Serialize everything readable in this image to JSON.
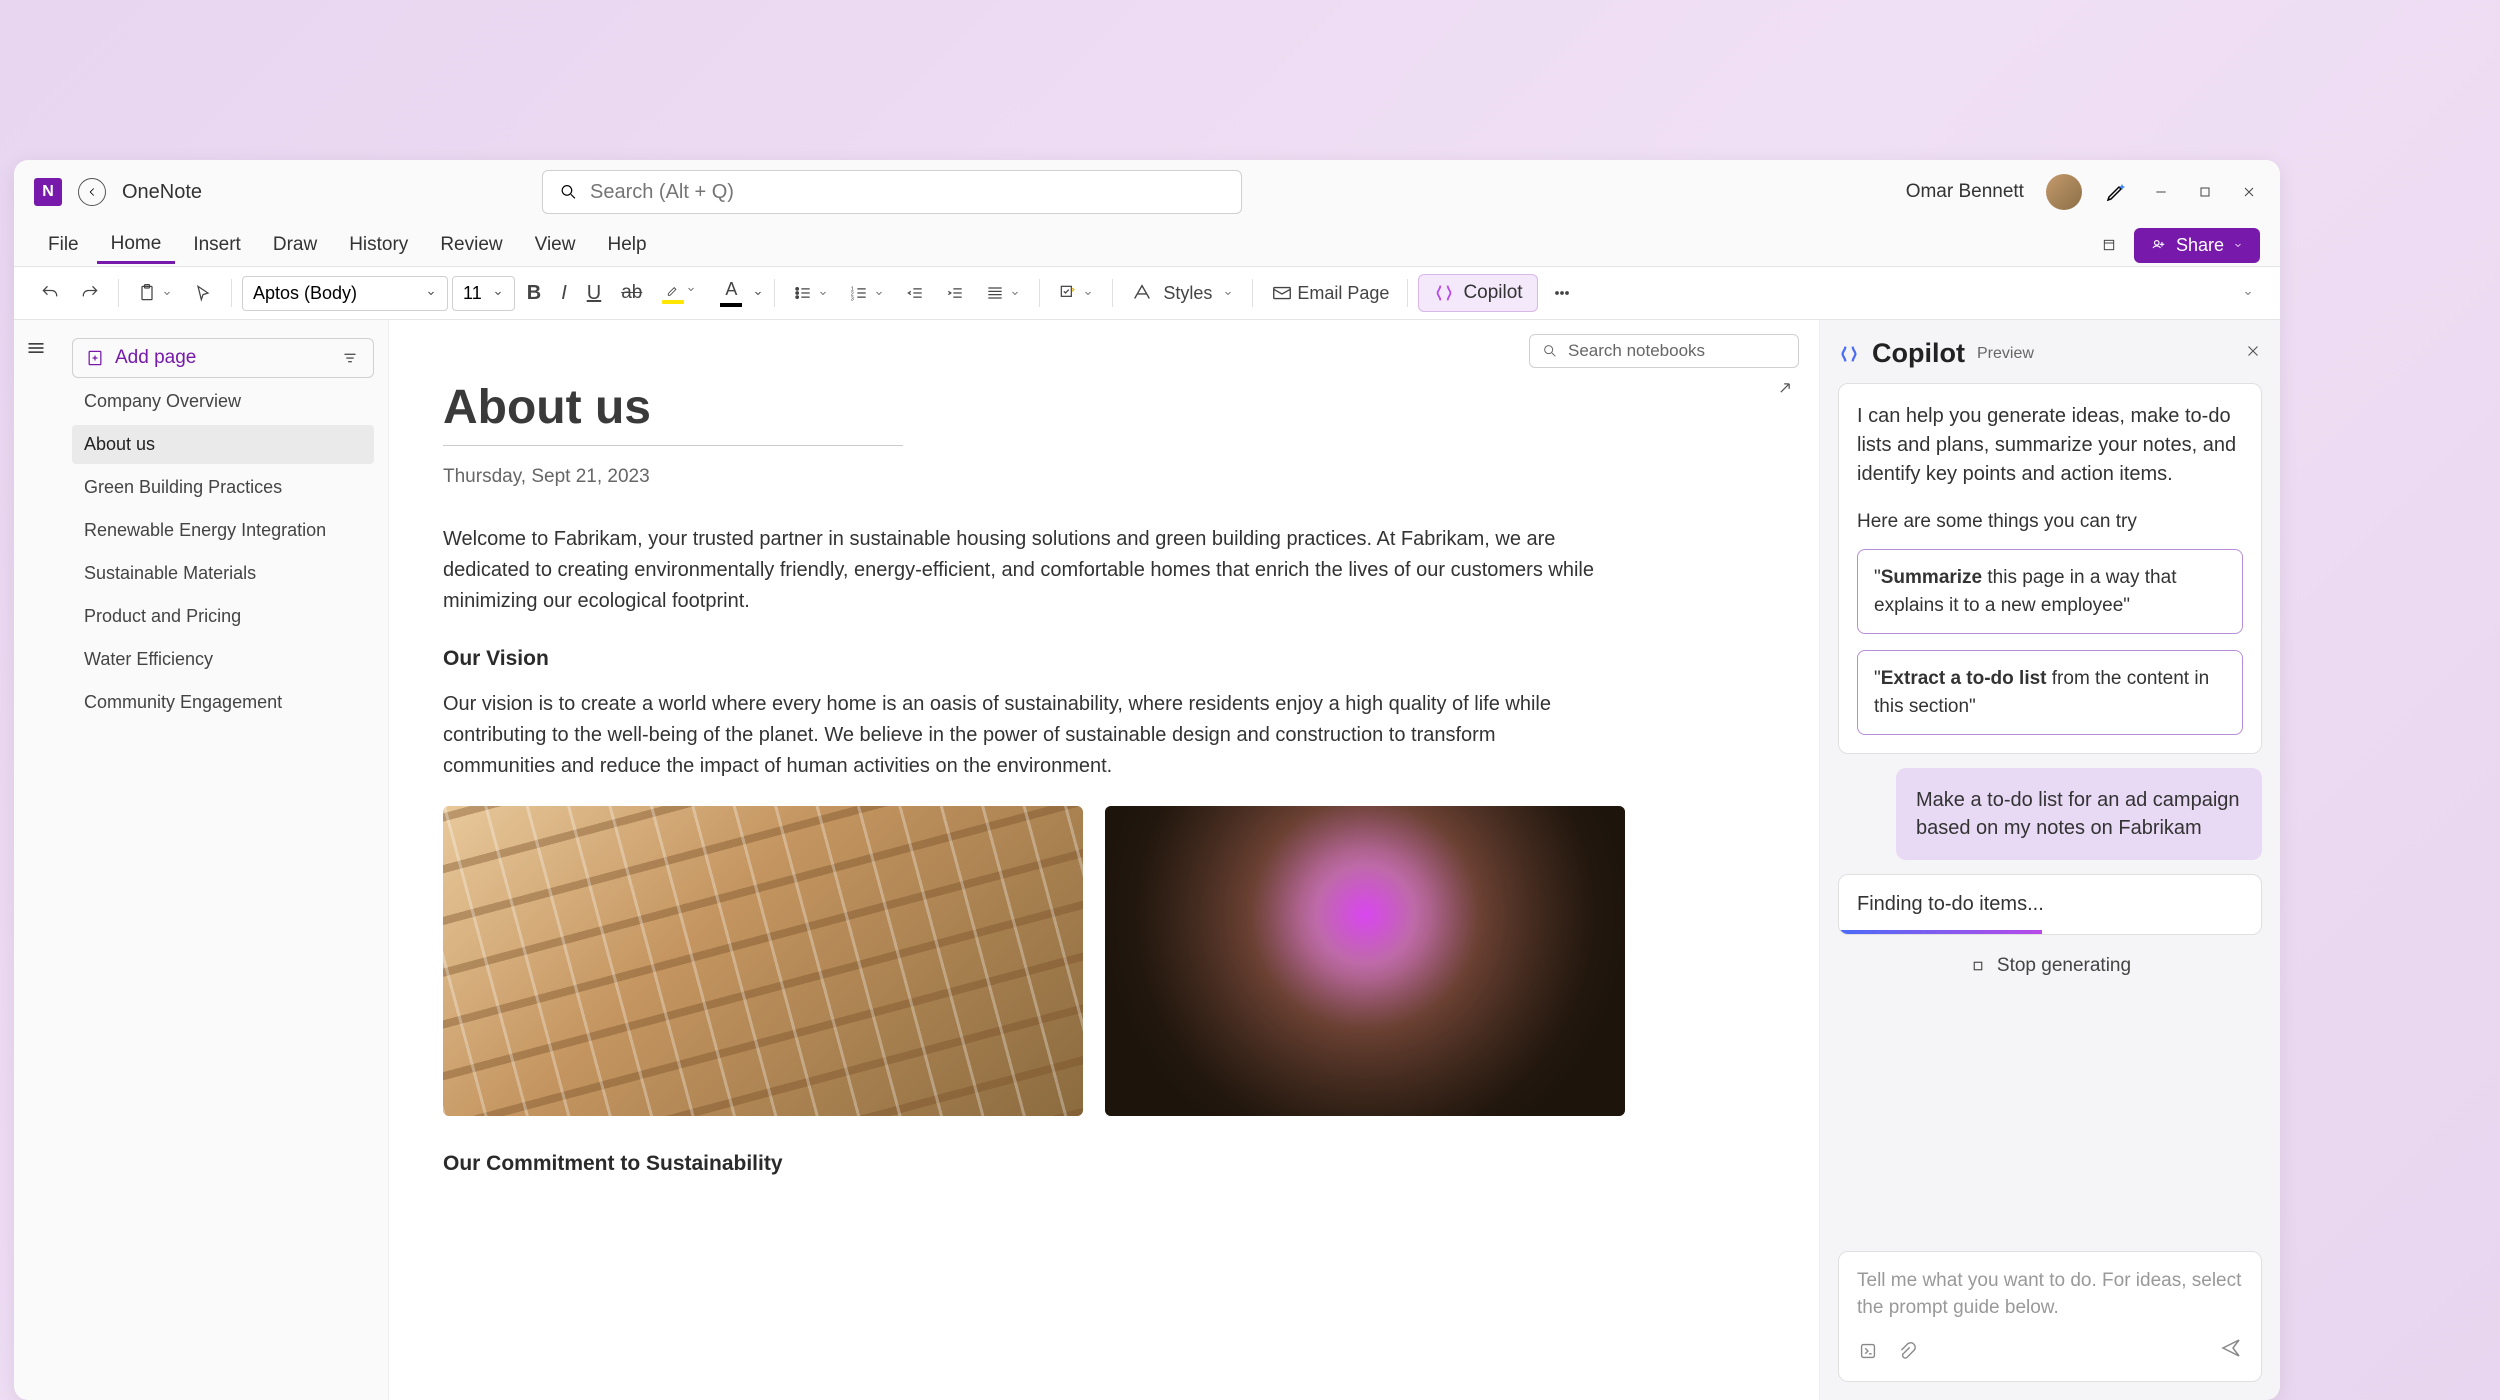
{
  "app": {
    "name": "OneNote"
  },
  "user": {
    "name": "Omar Bennett"
  },
  "search": {
    "global_placeholder": "Search (Alt + Q)",
    "notebooks_placeholder": "Search notebooks"
  },
  "menubar": {
    "items": [
      "File",
      "Home",
      "Insert",
      "Draw",
      "History",
      "Review",
      "View",
      "Help"
    ],
    "active_index": 1,
    "share_label": "Share"
  },
  "toolbar": {
    "font": "Aptos (Body)",
    "size": "11",
    "styles_label": "Styles",
    "email_label": "Email Page",
    "copilot_label": "Copilot"
  },
  "sidebar": {
    "add_page_label": "Add page",
    "pages": [
      "Company Overview",
      "About us",
      "Green Building Practices",
      "Renewable Energy Integration",
      "Sustainable Materials",
      "Product and Pricing",
      "Water Efficiency",
      "Community Engagement"
    ],
    "selected_index": 1
  },
  "page": {
    "title": "About us",
    "date": "Thursday, Sept 21, 2023",
    "intro": "Welcome to Fabrikam, your trusted partner in sustainable housing solutions and green building practices. At Fabrikam, we are dedicated to creating environmentally friendly, energy-efficient, and comfortable homes that enrich the lives of our customers while minimizing our ecological footprint.",
    "vision_h": "Our Vision",
    "vision_text": "Our vision is to create a world where every home is an oasis of sustainability, where residents enjoy a high quality of life while contributing to the well-being of the planet. We believe in the power of sustainable design and construction to transform communities and reduce the impact of human activities on the environment.",
    "commit_h": "Our Commitment to Sustainability"
  },
  "copilot": {
    "title": "Copilot",
    "preview": "Preview",
    "intro": "I can help you generate ideas, make to-do lists and plans, summarize your notes, and identify key points and action items.",
    "try_label": "Here are some things you can try",
    "suggest1_bold": "Summarize",
    "suggest1_rest": " this page in a way that explains it to a new employee\"",
    "suggest2_bold": "Extract a to-do list",
    "suggest2_rest": " from the content in this section\"",
    "user_msg": "Make a to-do list for an ad campaign based on my notes on Fabrikam",
    "status": "Finding to-do items...",
    "stop_label": "Stop generating",
    "input_placeholder": "Tell me what you want to do. For ideas, select the prompt guide below."
  }
}
